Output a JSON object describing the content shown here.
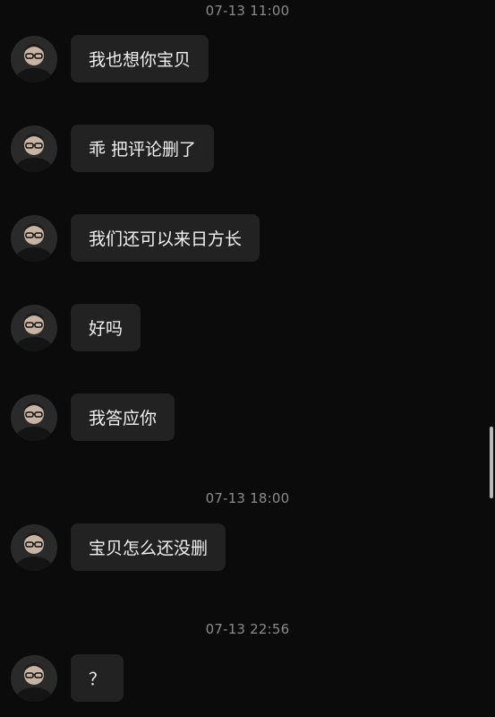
{
  "timestamps": [
    "07-13 11:00",
    "07-13 18:00",
    "07-13 22:56"
  ],
  "messages": [
    {
      "text": "我也想你宝贝"
    },
    {
      "text": "乖 把评论删了"
    },
    {
      "text": "我们还可以来日方长"
    },
    {
      "text": "好吗"
    },
    {
      "text": "我答应你"
    },
    {
      "text": "宝贝怎么还没删"
    },
    {
      "text": "？"
    }
  ],
  "avatar_icon": "avatar-glasses-man",
  "colors": {
    "background": "#0b0b0b",
    "bubble": "#222222",
    "timestamp": "#8b8b8b",
    "text": "#f1f1f1"
  }
}
